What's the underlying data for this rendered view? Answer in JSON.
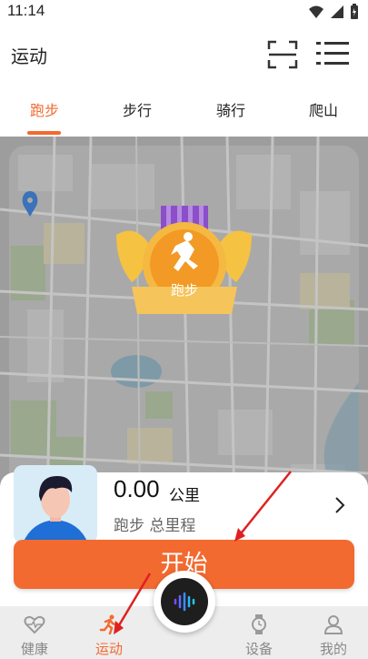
{
  "status_bar": {
    "time": "11:14"
  },
  "header": {
    "title": "运动"
  },
  "tabs": [
    {
      "label": "跑步",
      "active": true
    },
    {
      "label": "步行",
      "active": false
    },
    {
      "label": "骑行",
      "active": false
    },
    {
      "label": "爬山",
      "active": false
    }
  ],
  "badge": {
    "label": "跑步"
  },
  "summary": {
    "distance_value": "0.00",
    "distance_unit": "公里",
    "distance_label": "跑步 总里程"
  },
  "start_button": {
    "label": "开始"
  },
  "bottom_nav": [
    {
      "label": "健康",
      "icon": "heart-icon",
      "active": false
    },
    {
      "label": "运动",
      "icon": "running-icon",
      "active": true
    },
    {
      "label": "设备",
      "icon": "watch-icon",
      "active": false
    },
    {
      "label": "我的",
      "icon": "profile-icon",
      "active": false
    }
  ],
  "colors": {
    "accent": "#f26a30",
    "map": "#9d9d9d",
    "badge_gold": "#f5a623"
  }
}
